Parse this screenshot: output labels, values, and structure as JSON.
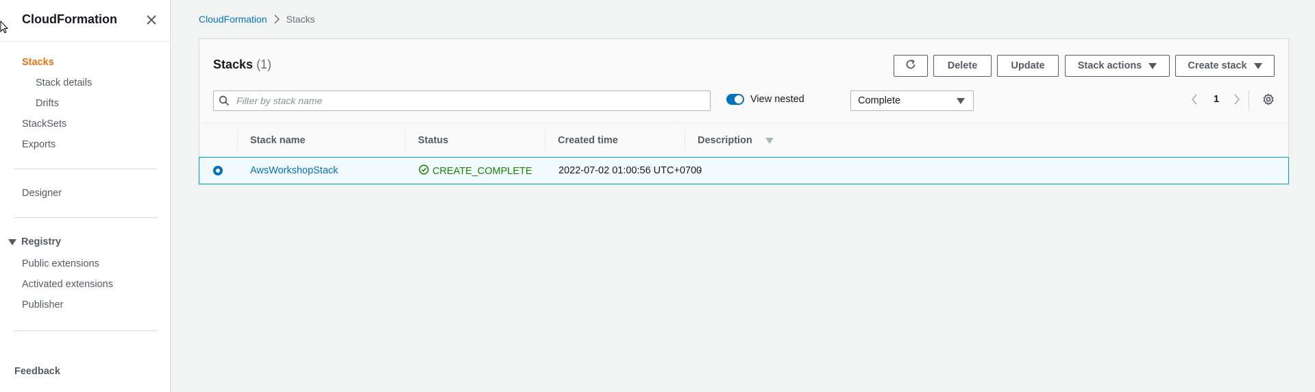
{
  "sidebar": {
    "title": "CloudFormation",
    "items": {
      "stacks": "Stacks",
      "stack_details": "Stack details",
      "drifts": "Drifts",
      "stacksets": "StackSets",
      "exports": "Exports",
      "designer": "Designer",
      "registry": "Registry",
      "public_extensions": "Public extensions",
      "activated_extensions": "Activated extensions",
      "publisher": "Publisher"
    },
    "feedback": "Feedback"
  },
  "breadcrumb": {
    "root": "CloudFormation",
    "current": "Stacks"
  },
  "panel": {
    "title": "Stacks",
    "count": "(1)",
    "buttons": {
      "delete": "Delete",
      "update": "Update",
      "stack_actions": "Stack actions",
      "create_stack": "Create stack"
    },
    "search_placeholder": "Filter by stack name",
    "view_nested_label": "View nested",
    "view_nested_on": true,
    "filter_selected": "Complete",
    "page": "1"
  },
  "table": {
    "columns": [
      "Stack name",
      "Status",
      "Created time",
      "Description"
    ],
    "rows": [
      {
        "stack_name": "AwsWorkshopStack",
        "status": "CREATE_COMPLETE",
        "created_time": "2022-07-02 01:00:56 UTC+0700",
        "description": "-",
        "selected": true
      }
    ]
  },
  "colors": {
    "accent": "#0073bb",
    "active_nav": "#ec7211",
    "status_ok": "#1d8102",
    "selected_row": "#f1faff"
  }
}
